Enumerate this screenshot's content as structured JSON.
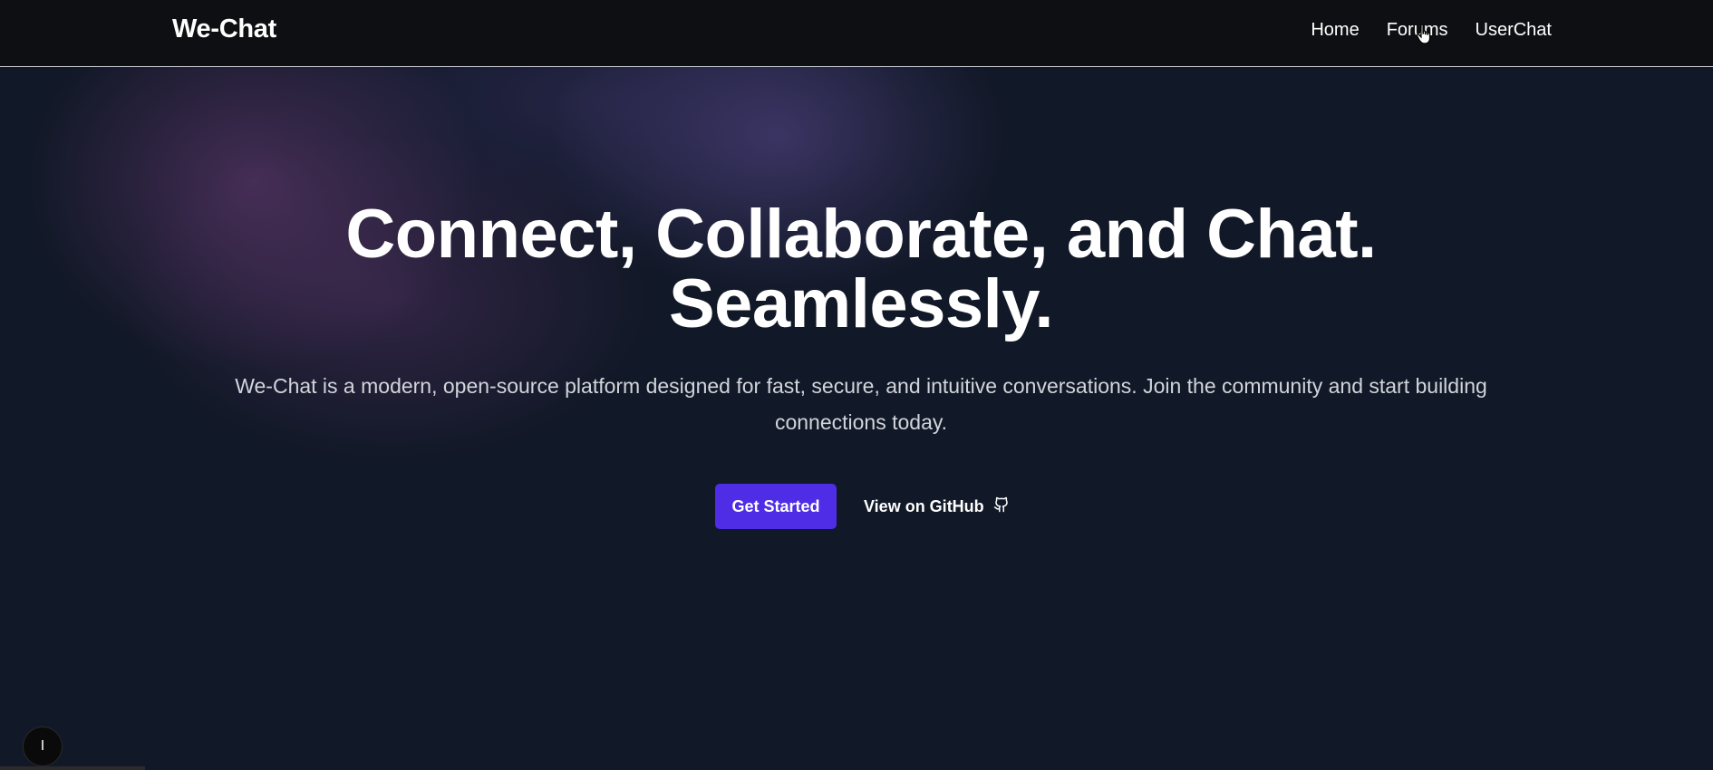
{
  "navbar": {
    "brand": "We-Chat",
    "links": [
      {
        "label": "Home"
      },
      {
        "label": "Forums"
      },
      {
        "label": "UserChat"
      }
    ]
  },
  "hero": {
    "headline_line1": "Connect, Collaborate, and Chat.",
    "headline_line2": "Seamlessly.",
    "subtitle": "We-Chat is a modern, open-source platform designed for fast, secure, and intuitive conversations. Join the community and start building connections today.",
    "primary_button": "Get Started",
    "secondary_button": "View on GitHub",
    "secondary_icon": "github-icon"
  },
  "floating_button": {
    "label": "I"
  },
  "colors": {
    "background": "#111827",
    "navbar": "#0e0f12",
    "accent": "#4f2ce6",
    "text": "#ffffff",
    "muted_text": "#d1d5db"
  }
}
